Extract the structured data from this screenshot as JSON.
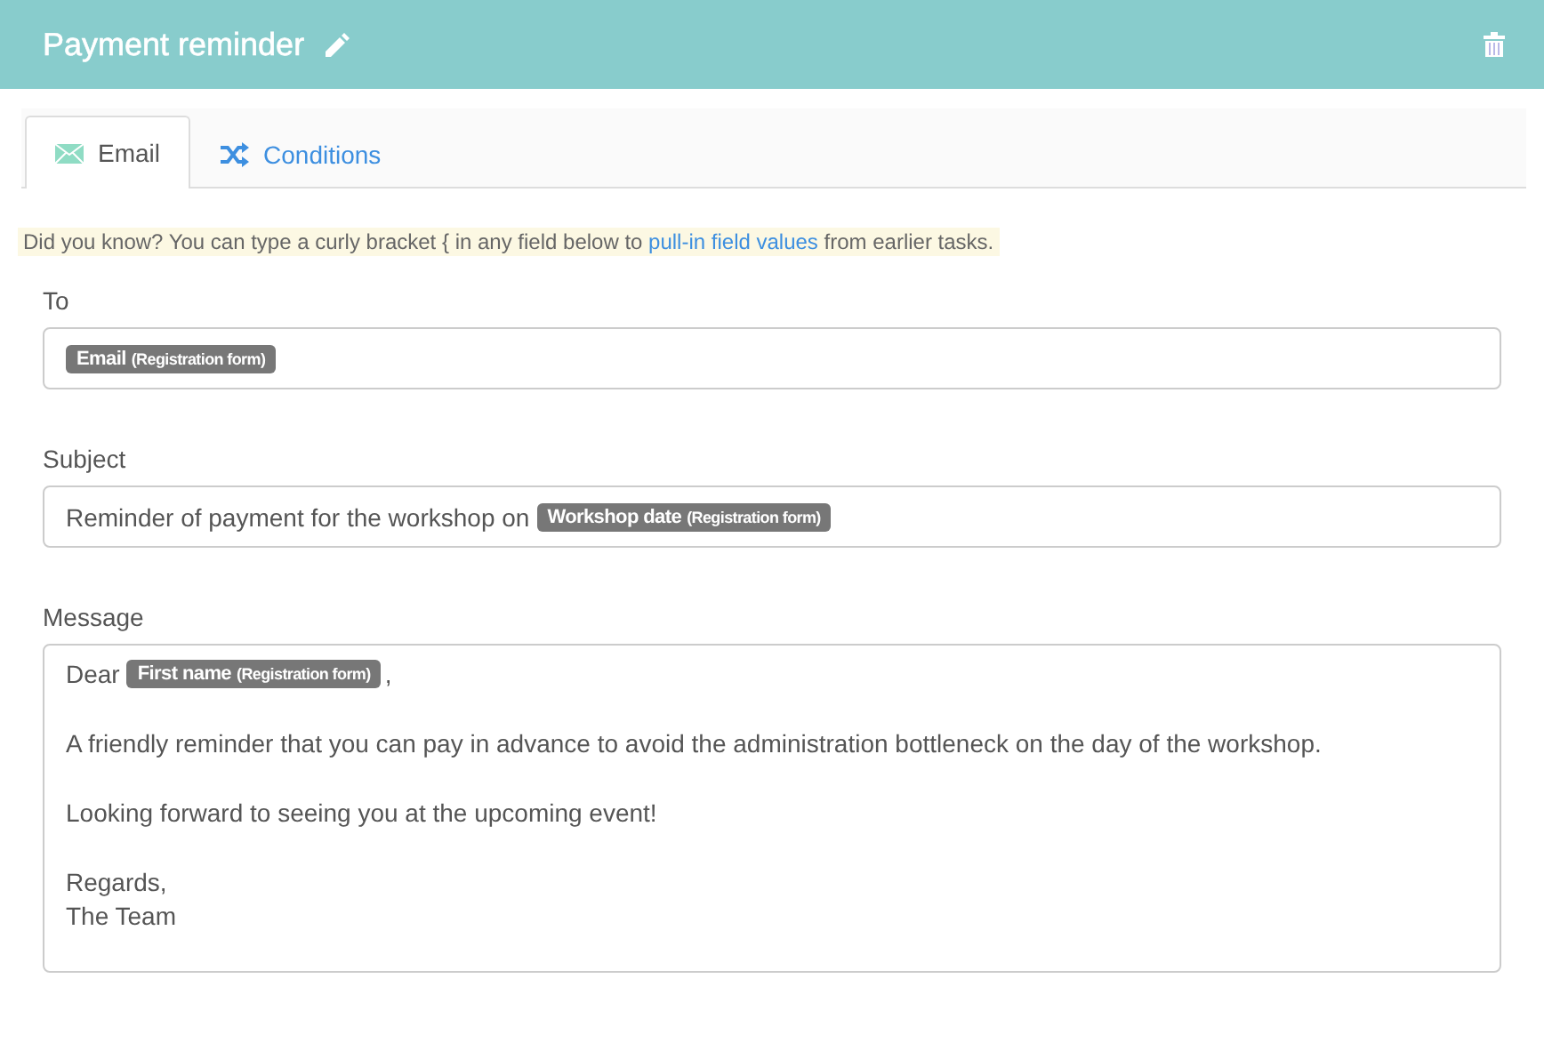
{
  "header": {
    "title": "Payment reminder"
  },
  "tabs": [
    {
      "label": "Email",
      "kind": "email",
      "selected": true
    },
    {
      "label": "Conditions",
      "kind": "conditions",
      "selected": false
    }
  ],
  "hint": {
    "before": "Did you know? You can type a curly bracket { in any field below to ",
    "link": "pull-in field values",
    "after": " from earlier tasks."
  },
  "fields": [
    {
      "label": "To",
      "kind": "line",
      "paragraphs": [
        [
          [
            {
              "kind": "tag",
              "name": "Email",
              "source": "(Registration form)"
            }
          ]
        ]
      ]
    },
    {
      "label": "Subject",
      "kind": "line",
      "paragraphs": [
        [
          [
            {
              "kind": "text",
              "text": "Reminder of payment for the workshop on"
            },
            {
              "kind": "tag",
              "name": "Workshop date",
              "source": "(Registration form)"
            }
          ]
        ]
      ]
    },
    {
      "label": "Message",
      "kind": "area",
      "paragraphs": [
        [
          [
            {
              "kind": "text",
              "text": "Dear"
            },
            {
              "kind": "tag",
              "name": "First name",
              "source": "(Registration form)"
            },
            {
              "kind": "text",
              "text": ","
            }
          ]
        ],
        [
          [
            {
              "kind": "text",
              "text": "A friendly reminder that you can pay in advance to avoid the administration bottleneck on the day of the workshop."
            }
          ]
        ],
        [
          [
            {
              "kind": "text",
              "text": "Looking forward to seeing you at the upcoming event!"
            }
          ]
        ],
        [
          [
            {
              "kind": "text",
              "text": "Regards,"
            }
          ],
          [
            {
              "kind": "text",
              "text": "The Team"
            }
          ]
        ]
      ]
    }
  ]
}
